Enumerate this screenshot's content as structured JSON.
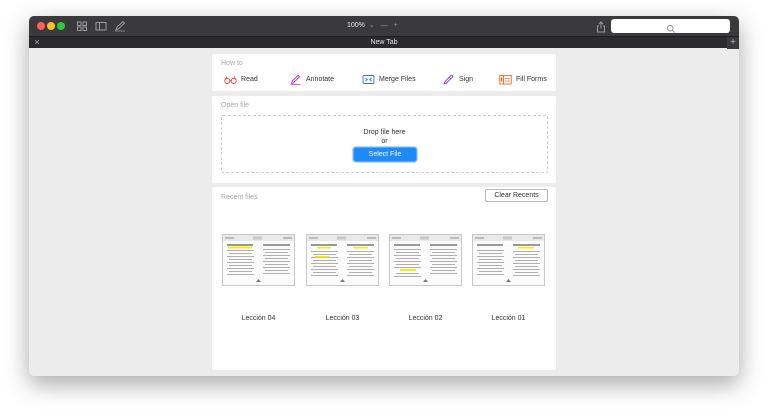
{
  "toolbar": {
    "zoom_level": "100%",
    "zoom_chevron": "⌄",
    "zoom_out": "—",
    "zoom_in": "+",
    "icons": [
      "grid-icon",
      "sidebar-icon",
      "pen-icon",
      "share-icon",
      "search-icon"
    ]
  },
  "tab": {
    "close": "×",
    "title": "New Tab",
    "new": "+"
  },
  "howto": {
    "label": "How to",
    "items": [
      {
        "label": "Read",
        "icon": "glasses-icon",
        "color": "#e8453c"
      },
      {
        "label": "Annotate",
        "icon": "pen-icon",
        "color": "#c22ad6"
      },
      {
        "label": "Merge Files",
        "icon": "merge-icon",
        "color": "#2a72e5"
      },
      {
        "label": "Sign",
        "icon": "signature-icon",
        "color": "#9b3bd6"
      },
      {
        "label": "Fill Forms",
        "icon": "form-icon",
        "color": "#ee6a2a"
      }
    ]
  },
  "open_file": {
    "label": "Open file",
    "drop_text": "Drop file here",
    "or_text": "or",
    "select_button": "Select File"
  },
  "recent": {
    "label": "Recent files",
    "clear_button": "Clear Recents",
    "files": [
      {
        "name": "Lección 04"
      },
      {
        "name": "Lección 03"
      },
      {
        "name": "Lección 02"
      },
      {
        "name": "Lección 01"
      }
    ]
  },
  "colors": {
    "accent": "#1d8af5",
    "titlebar": "#3a3a3c",
    "highlight": "#f3f000"
  }
}
